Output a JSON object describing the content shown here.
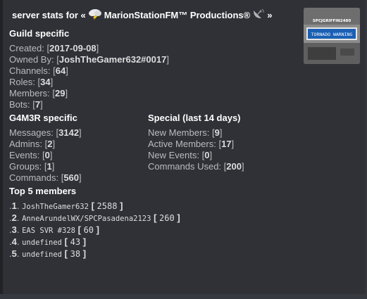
{
  "author": {
    "prefix": "server stats for «",
    "server_name": "MarionStationFM™ Productions®",
    "suffix": "»",
    "icons": [
      "cloud-lightning-icon",
      "satellite-dish-icon"
    ]
  },
  "thumbnail": {
    "banner_text": "TORNADO WARNING",
    "watermark_text": "SPCJGRIFFIN2480"
  },
  "guild": {
    "title": "Guild specific",
    "created_label": "Created:",
    "created_value": "2017-09-08",
    "owner_label": "Owned By:",
    "owner_value": "JoshTheGamer632#0017",
    "channels_label": "Channels:",
    "channels_value": "64",
    "roles_label": "Roles:",
    "roles_value": "34",
    "members_label": "Members:",
    "members_value": "29",
    "bots_label": "Bots:",
    "bots_value": "7"
  },
  "g4m3r": {
    "title": "G4M3R specific",
    "messages_label": "Messages:",
    "messages_value": "3142",
    "admins_label": "Admins:",
    "admins_value": "2",
    "events_label": "Events:",
    "events_value": "0",
    "groups_label": "Groups:",
    "groups_value": "1",
    "commands_label": "Commands:",
    "commands_value": "560"
  },
  "special": {
    "title": "Special (last 14 days)",
    "new_members_label": "New Members:",
    "new_members_value": "9",
    "active_members_label": "Active Members:",
    "active_members_value": "17",
    "new_events_label": "New Events:",
    "new_events_value": "0",
    "commands_used_label": "Commands Used:",
    "commands_used_value": "200"
  },
  "top5": {
    "title": "Top 5 members",
    "members": [
      {
        "rank": "1",
        "name": "JoshTheGamer632",
        "score": "2588"
      },
      {
        "rank": "2",
        "name": "AnneArundelWX/SPCPasadena2123",
        "score": "260"
      },
      {
        "rank": "3",
        "name": "EAS SVR #328",
        "score": "60"
      },
      {
        "rank": "4",
        "name": "undefined",
        "score": "43"
      },
      {
        "rank": "5",
        "name": "undefined",
        "score": "38"
      }
    ]
  }
}
